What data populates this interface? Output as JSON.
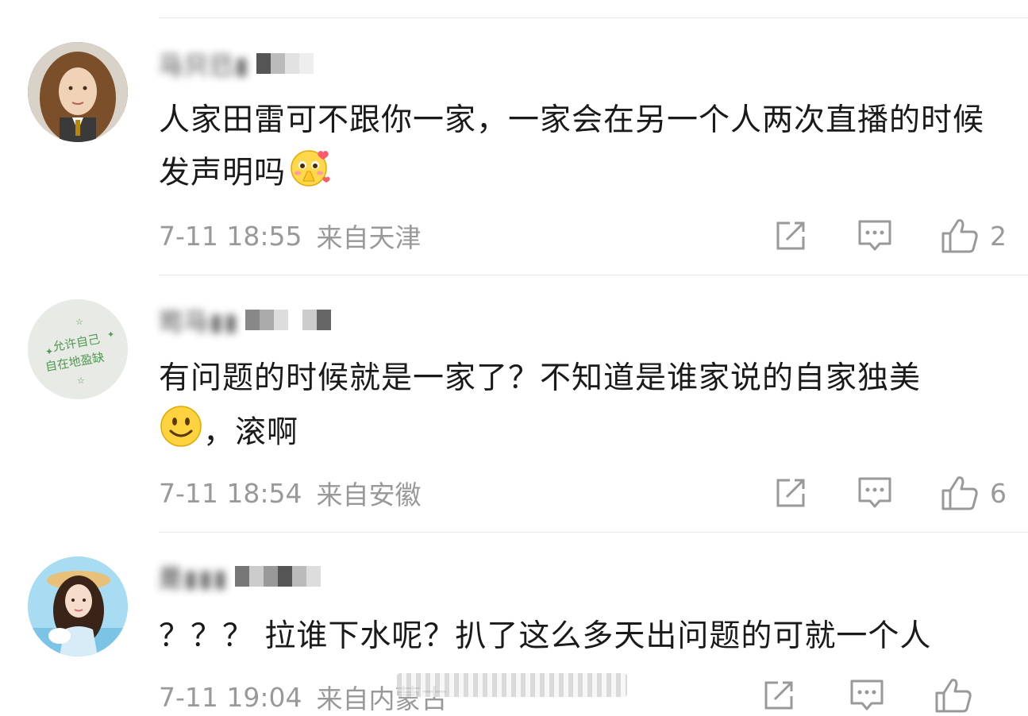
{
  "comments": [
    {
      "username": "马只已▮",
      "text": "人家田雷可不跟你一家，一家会在另一个人两次直播的时候发声明吗",
      "emoji": "shy-blush-emoji",
      "time": "7-11 18:55",
      "location": "来自天津",
      "likes": "2"
    },
    {
      "username": "司马▮▮",
      "text_line1": "有问题的时候就是一家了？不知道是谁家说的自家独美",
      "text_line2": "，滚啊",
      "emoji": "smile-emoji",
      "time": "7-11 18:54",
      "location": "来自安徽",
      "likes": "6"
    },
    {
      "username": "是▮▮▮",
      "text": "？？？ 拉谁下水呢？扒了这么多天出问题的可就一个人",
      "time": "7-11 19:04",
      "location": "来自内蒙古",
      "likes": ""
    }
  ],
  "avatar2_text": "允许自己自在地盈缺",
  "icons": {
    "repost": "share-icon",
    "comment": "comment-icon",
    "like": "thumbs-up-icon"
  },
  "colors": {
    "text": "#1a1a1a",
    "meta": "#999999",
    "divider": "#e6e6e6"
  }
}
